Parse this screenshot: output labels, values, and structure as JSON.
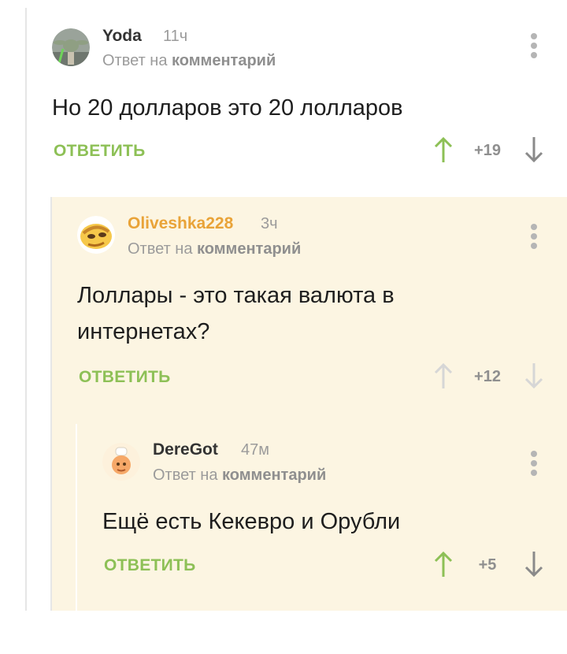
{
  "comments": [
    {
      "author": "Yoda",
      "time": "11ч",
      "reply_prefix": "Ответ на",
      "reply_link": "комментарий",
      "text": "Но 20 долларов это 20 лолларов",
      "reply_label": "ОТВЕТИТЬ",
      "score": "+19",
      "author_color": "#333333",
      "upvoted": true
    },
    {
      "author": "Oliveshka228",
      "time": "3ч",
      "reply_prefix": "Ответ на",
      "reply_link": "комментарий",
      "text_line1": "Лоллары - это такая валюта в",
      "text_line2": "интернетах?",
      "reply_label": "ОТВЕТИТЬ",
      "score": "+12",
      "author_color": "#e9a338",
      "upvoted": false
    },
    {
      "author": "DereGot",
      "time": "47м",
      "reply_prefix": "Ответ на",
      "reply_link": "комментарий",
      "text": "Ещё есть Кекевро и Орубли",
      "reply_label": "ОТВЕТИТЬ",
      "score": "+5",
      "author_color": "#333333",
      "upvoted": true
    }
  ],
  "colors": {
    "accent_green": "#8dc056",
    "highlight_bg": "#fcf5e2",
    "muted": "#9b9b9b"
  }
}
